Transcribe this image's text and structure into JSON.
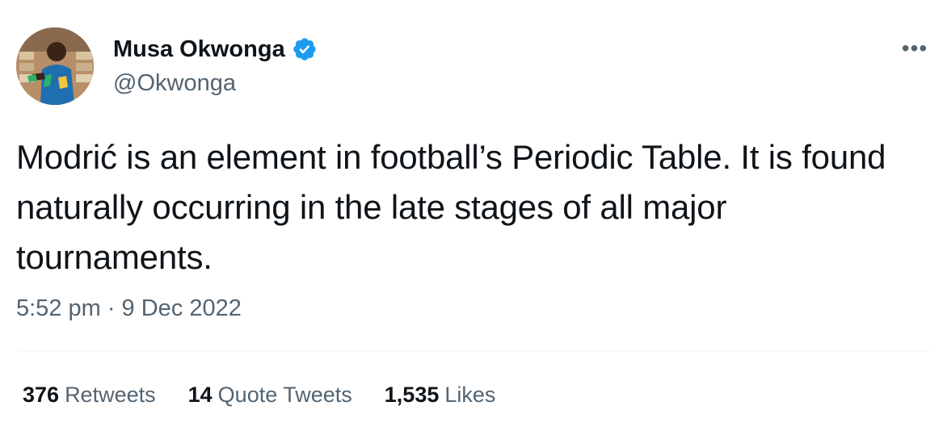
{
  "user": {
    "display_name": "Musa Okwonga",
    "handle": "@Okwonga",
    "verified": true
  },
  "tweet": {
    "text": "Modrić is an element in football’s Periodic Table. It is found naturally occurring in the late stages of all major tournaments.",
    "timestamp": "5:52 pm · 9 Dec 2022"
  },
  "stats": {
    "retweets": {
      "count": "376",
      "label": "Retweets"
    },
    "quote_tweets": {
      "count": "14",
      "label": "Quote Tweets"
    },
    "likes": {
      "count": "1,535",
      "label": "Likes"
    }
  },
  "icons": {
    "more": "more-horizontal-icon",
    "verified": "verified-badge-icon"
  },
  "colors": {
    "text_primary": "#0f1419",
    "text_secondary": "#536471",
    "verified_blue": "#1d9bf0",
    "divider": "#eff3f4"
  }
}
